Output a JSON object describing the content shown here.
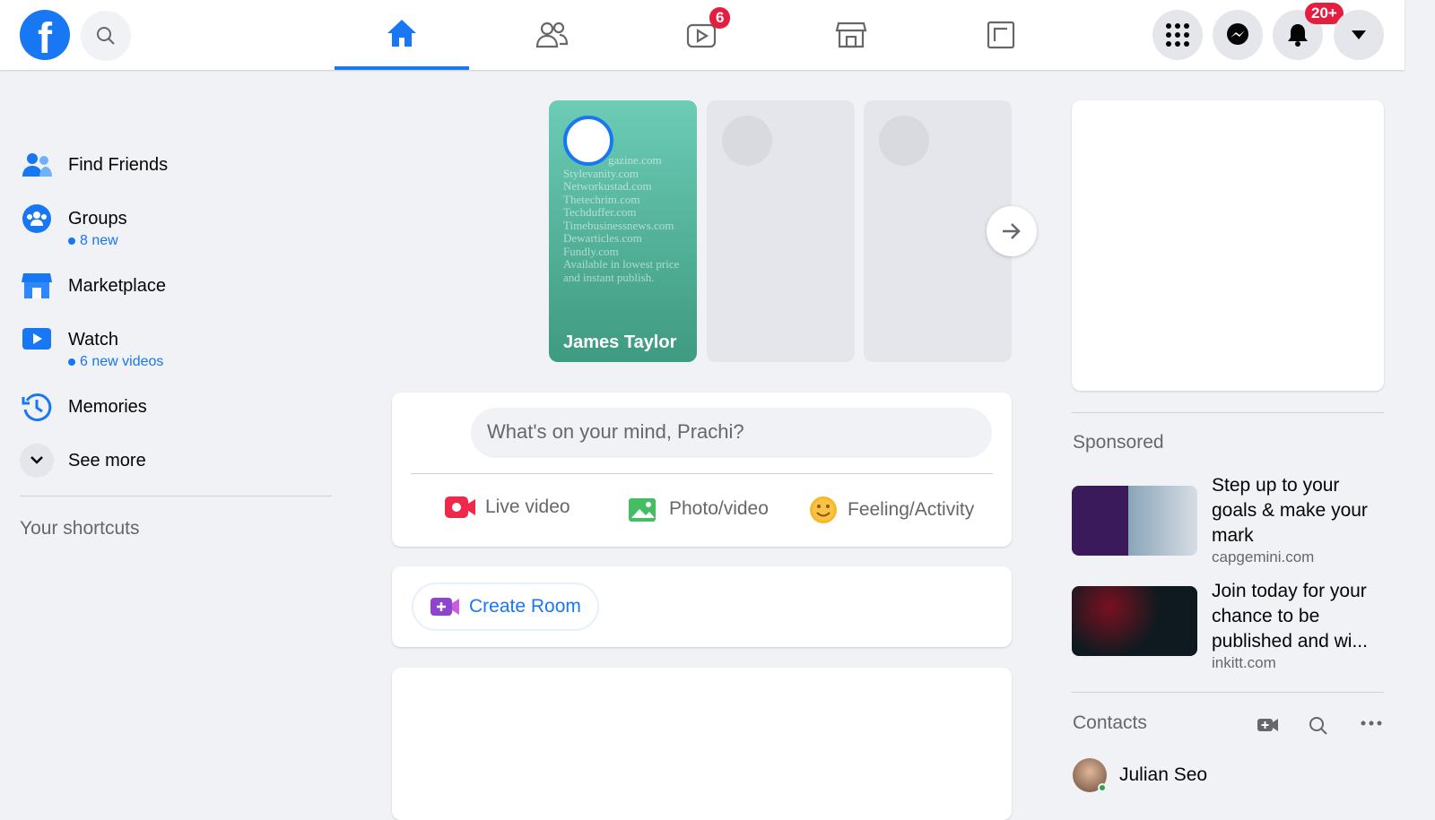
{
  "header": {
    "logo": "f",
    "notifications_badge": "20+",
    "watch_badge": "6",
    "tabs": [
      "home-icon",
      "friends-icon",
      "watch-icon",
      "marketplace-icon",
      "gaming-icon"
    ],
    "active_tab": "home"
  },
  "sidebar": {
    "items": [
      {
        "label": "Find Friends"
      },
      {
        "label": "Groups",
        "sub": "8 new"
      },
      {
        "label": "Marketplace"
      },
      {
        "label": "Watch",
        "sub": "6 new videos"
      },
      {
        "label": "Memories"
      },
      {
        "label": "See more"
      }
    ],
    "shortcuts_title": "Your shortcuts"
  },
  "stories": {
    "name": "James Taylor",
    "lines": [
      "gazine.com",
      "Stylevanity.com",
      "Networkustad.com",
      "Thetechrim.com",
      "Techduffer.com",
      "Timebusinessnews.com",
      "Dewarticles.com",
      "Fundly.com",
      "Available in lowest price",
      "and instant publish."
    ]
  },
  "composer": {
    "placeholder": "What's on your mind, Prachi?",
    "live": "Live video",
    "photo": "Photo/video",
    "feeling": "Feeling/Activity"
  },
  "room": {
    "label": "Create Room"
  },
  "sponsored": {
    "title": "Sponsored",
    "ads": [
      {
        "text": "Step up to your goals & make your mark",
        "domain": "capgemini.com"
      },
      {
        "text": "Join today for your chance to be published and wi...",
        "domain": "inkitt.com"
      }
    ]
  },
  "contacts": {
    "title": "Contacts",
    "people": [
      {
        "name": "Julian Seo"
      }
    ]
  },
  "colors": {
    "accent": "#1877f2",
    "badge": "#e41e3f",
    "background": "#f0f2f5"
  }
}
